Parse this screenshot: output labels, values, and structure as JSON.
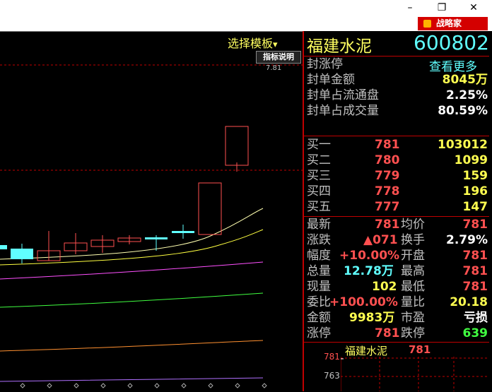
{
  "window": {
    "minimize": "–",
    "restore": "❐",
    "close": "✕"
  },
  "brand": {
    "label": "战略家",
    "icon": "cube-icon"
  },
  "chart": {
    "template_label": "选择模板",
    "template_arrow": "▾",
    "indicator_button": "指标说明",
    "price_readout": "7.81",
    "ma_lines": [
      {
        "color": "#ffffb0"
      },
      {
        "color": "#ffff40"
      },
      {
        "color": "#ff50ff"
      },
      {
        "color": "#40ff40"
      },
      {
        "color": "#ff9030"
      },
      {
        "color": "#b070ff"
      }
    ]
  },
  "stock": {
    "name": "福建水泥",
    "code": "600802",
    "more": "查看更多"
  },
  "limit": [
    {
      "label": "封涨停",
      "value": ""
    },
    {
      "label": "封单金额",
      "value": "8045万"
    },
    {
      "label": "封单占流通盘",
      "value": "2.25%"
    },
    {
      "label": "封单占成交量",
      "value": "80.59%"
    }
  ],
  "bids": [
    {
      "label": "买一",
      "price": "781",
      "volume": "103012"
    },
    {
      "label": "买二",
      "price": "780",
      "volume": "1099"
    },
    {
      "label": "买三",
      "price": "779",
      "volume": "159"
    },
    {
      "label": "买四",
      "price": "778",
      "volume": "196"
    },
    {
      "label": "买五",
      "price": "777",
      "volume": "147"
    }
  ],
  "quote": {
    "latest_label": "最新",
    "latest": "781",
    "avg_label": "均价",
    "avg": "781",
    "change_label": "涨跌",
    "change": "▲071",
    "turnover_label": "换手",
    "turnover": "2.79%",
    "amp_label": "幅度",
    "amp": "+10.00%",
    "open_label": "开盘",
    "open": "781",
    "vol_label": "总量",
    "vol": "12.78万",
    "high_label": "最高",
    "high": "781",
    "cur_label": "现量",
    "cur": "102",
    "low_label": "最低",
    "low": "781",
    "ratio_label": "委比",
    "ratio": "+100.00%",
    "volratio_label": "量比",
    "volratio": "20.18",
    "amount_label": "金额",
    "amount": "9983万",
    "pe_label": "市盈",
    "pe": "亏损",
    "up_label": "涨停",
    "up": "781",
    "down_label": "跌停",
    "down": "639"
  },
  "mini": {
    "title": "福建水泥",
    "price": "781",
    "tick_high": "781",
    "tick_low": "763"
  }
}
